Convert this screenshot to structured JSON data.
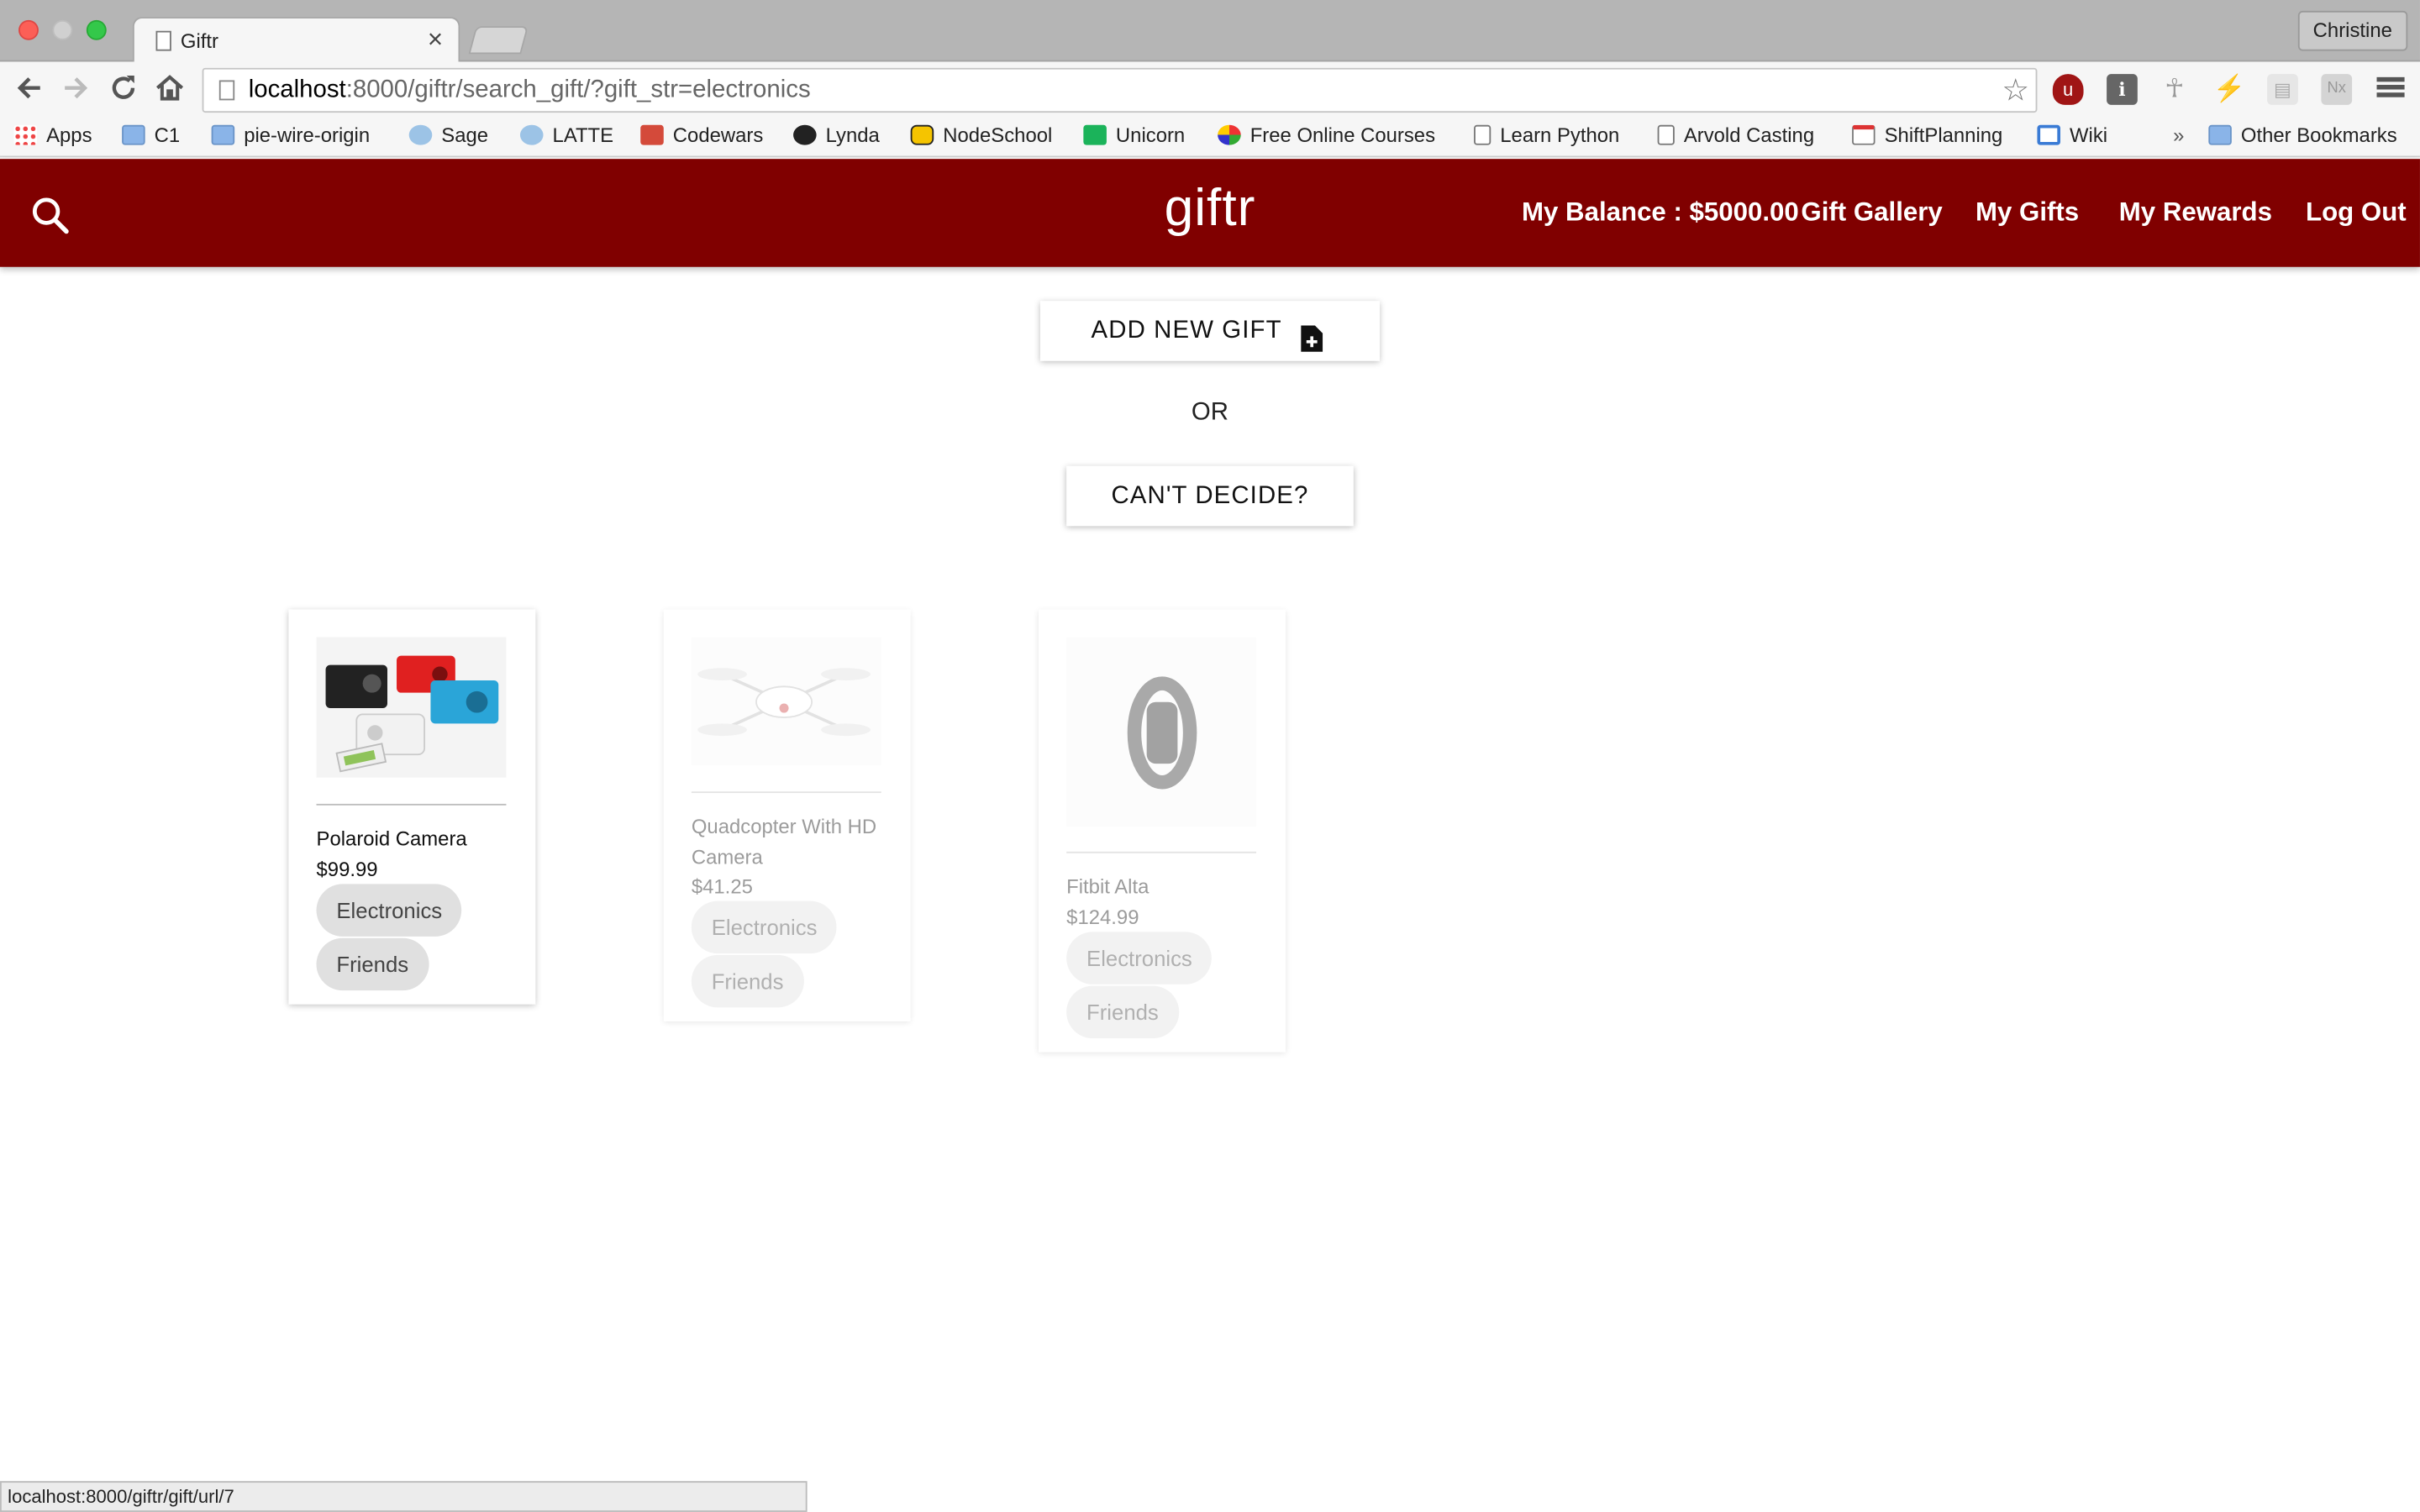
{
  "browser": {
    "tab_title": "Giftr",
    "tab_close": "×",
    "profile_name": "Christine",
    "url_host": "localhost",
    "url_path": ":8000/giftr/search_gift/?gift_str=electronics",
    "bookmarks": [
      "Apps",
      "C1",
      "pie-wire-origin",
      "Sage",
      "LATTE",
      "Codewars",
      "Lynda",
      "NodeSchool",
      "Unicorn",
      "Free Online Courses",
      "Learn Python",
      "Arvold Casting",
      "ShiftPlanning",
      "Wiki"
    ],
    "bookmarks_overflow": "»",
    "other_bookmarks": "Other Bookmarks",
    "status_url": "localhost:8000/giftr/gift/url/7"
  },
  "app": {
    "brand": "giftr",
    "nav": {
      "balance": "My Balance : $5000.00",
      "gallery": "Gift Gallery",
      "my_gifts": "My Gifts",
      "rewards": "My Rewards",
      "logout": "Log Out"
    },
    "add_new_gift": "ADD NEW GIFT",
    "or": "OR",
    "cant_decide": "CAN'T DECIDE?",
    "colors": {
      "appbar": "#800000",
      "chip": "#e0e0e0"
    },
    "gifts": [
      {
        "name": "Polaroid Camera",
        "price": "$99.99",
        "tags": [
          "Electronics",
          "Friends"
        ],
        "image": "polaroid-camera-image"
      },
      {
        "name": "Quadcopter With HD Camera",
        "price": "$41.25",
        "tags": [
          "Electronics",
          "Friends"
        ],
        "image": "quadcopter-drone-image"
      },
      {
        "name": "Fitbit Alta",
        "price": "$124.99",
        "tags": [
          "Electronics",
          "Friends"
        ],
        "image": "fitbit-band-image"
      }
    ]
  }
}
